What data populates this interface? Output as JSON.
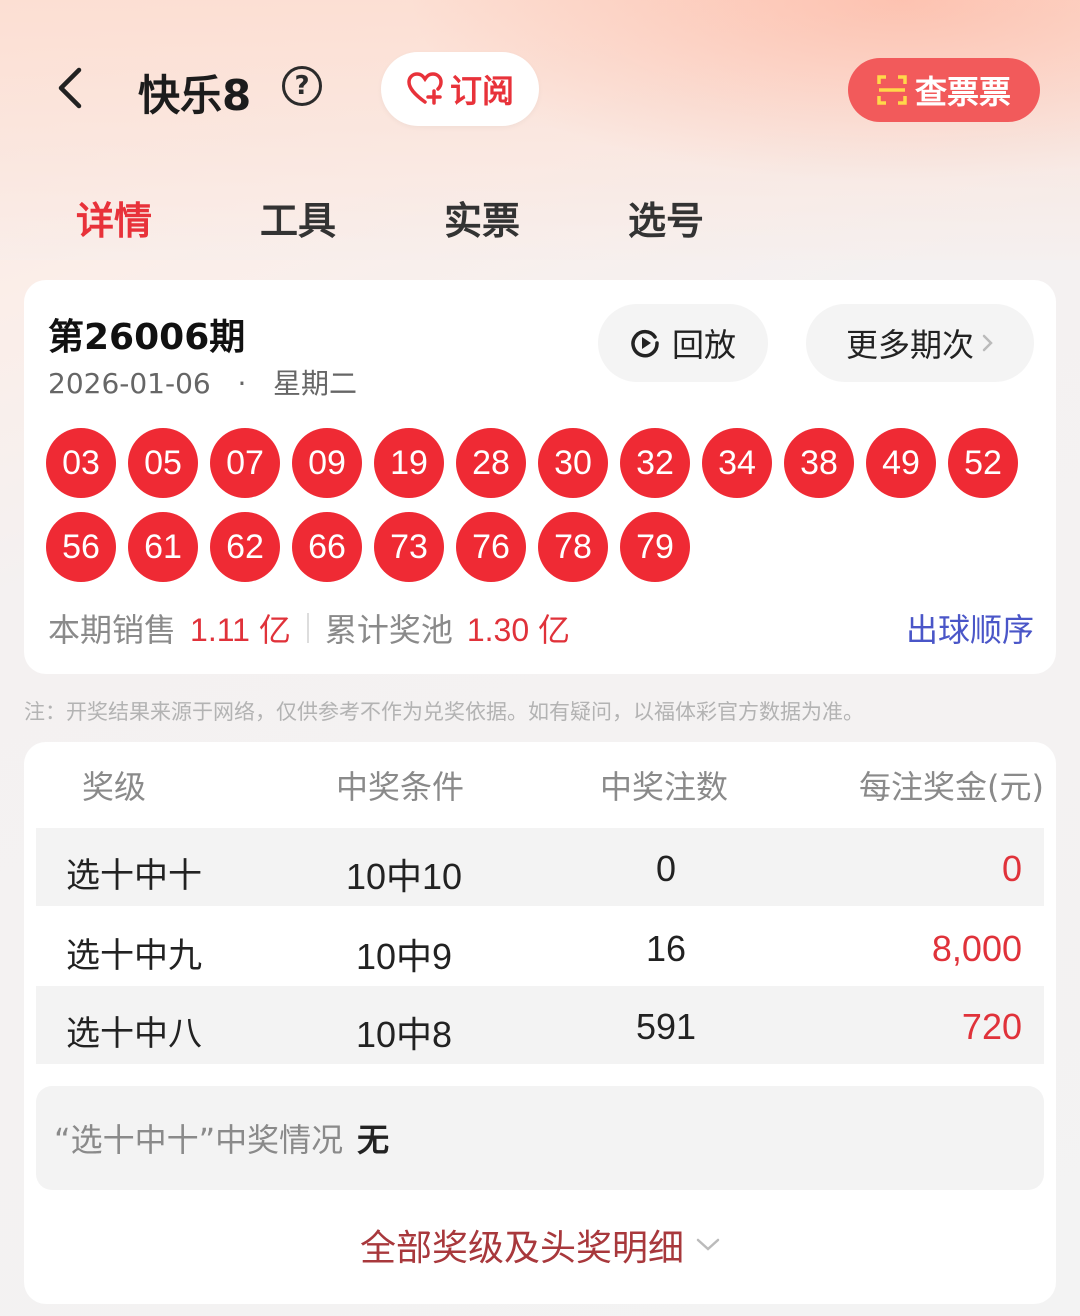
{
  "header": {
    "title": "快乐8",
    "help_icon": "?",
    "subscribe_label": "订阅",
    "check_ticket_label": "查票票"
  },
  "tabs": [
    {
      "label": "详情",
      "active": true
    },
    {
      "label": "工具",
      "active": false
    },
    {
      "label": "实票",
      "active": false
    },
    {
      "label": "选号",
      "active": false
    }
  ],
  "draw": {
    "issue": "第26006期",
    "date": "2026-01-06",
    "dot": "·",
    "weekday": "星期二",
    "replay_label": "回放",
    "more_issues_label": "更多期次",
    "numbers": [
      "03",
      "05",
      "07",
      "09",
      "19",
      "28",
      "30",
      "32",
      "34",
      "38",
      "49",
      "52",
      "56",
      "61",
      "62",
      "66",
      "73",
      "76",
      "78",
      "79"
    ],
    "sales_label": "本期销售",
    "sales_value": "1.11 亿",
    "pool_label": "累计奖池",
    "pool_value": "1.30 亿",
    "order_link": "出球顺序"
  },
  "note": "注：开奖结果来源于网络，仅供参考不作为兑奖依据。如有疑问，以福体彩官方数据为准。",
  "prize_table": {
    "headers": [
      "奖级",
      "中奖条件",
      "中奖注数",
      "每注奖金(元)"
    ],
    "rows": [
      {
        "level": "选十中十",
        "condition": "10中10",
        "count": "0",
        "prize": "0"
      },
      {
        "level": "选十中九",
        "condition": "10中9",
        "count": "16",
        "prize": "8,000"
      },
      {
        "level": "选十中八",
        "condition": "10中8",
        "count": "591",
        "prize": "720"
      }
    ],
    "summary_label": "“选十中十”中奖情况",
    "summary_value": "无",
    "all_levels_label": "全部奖级及头奖明细"
  },
  "colors": {
    "accent_red": "#e8323a",
    "ball_red": "#ef2a34",
    "link_blue": "#4a56c8",
    "check_button": "#f25a5b"
  }
}
